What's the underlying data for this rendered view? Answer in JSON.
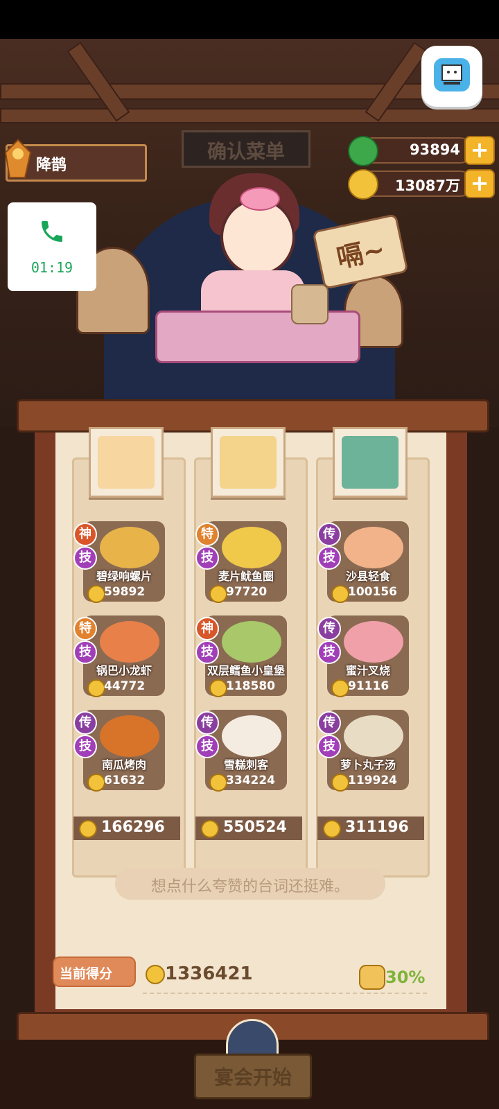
{
  "player": {
    "name": "降鹊"
  },
  "call": {
    "time": "01:19"
  },
  "currency": {
    "jade": "93894",
    "coins": "13087万"
  },
  "scene": {
    "sign": "确认菜单",
    "speech": "嗝~"
  },
  "columns": [
    {
      "total": "166296",
      "dishes": [
        {
          "grade": "神",
          "skill": "技",
          "name": "碧绿响螺片",
          "score": "59892"
        },
        {
          "grade": "特",
          "skill": "技",
          "name": "锅巴小龙虾",
          "score": "44772"
        },
        {
          "grade": "传",
          "skill": "技",
          "name": "南瓜烤肉",
          "score": "61632"
        }
      ]
    },
    {
      "total": "550524",
      "dishes": [
        {
          "grade": "特",
          "skill": "技",
          "name": "麦片鱿鱼圈",
          "score": "97720"
        },
        {
          "grade": "神",
          "skill": "技",
          "name": "双层鳕鱼小皇堡",
          "score": "118580"
        },
        {
          "grade": "传",
          "skill": "技",
          "name": "雪糕刺客",
          "score": "334224"
        }
      ]
    },
    {
      "total": "311196",
      "dishes": [
        {
          "grade": "传",
          "skill": "技",
          "name": "沙县轻食",
          "score": "100156"
        },
        {
          "grade": "传",
          "skill": "技",
          "name": "蜜汁叉烧",
          "score": "91116"
        },
        {
          "grade": "传",
          "skill": "技",
          "name": "萝卜丸子汤",
          "score": "119924"
        }
      ]
    }
  ],
  "dialog": "想点什么夸赞的台词还挺难。",
  "score": {
    "label": "当前得分",
    "value": "1336421",
    "bonus": "30%"
  },
  "start_button": "宴会开始",
  "colors": {
    "grade_shen": "#d9562a",
    "grade_te": "#e0822e",
    "grade_chuan": "#8a3fa0",
    "skill": "#a13fb8"
  }
}
